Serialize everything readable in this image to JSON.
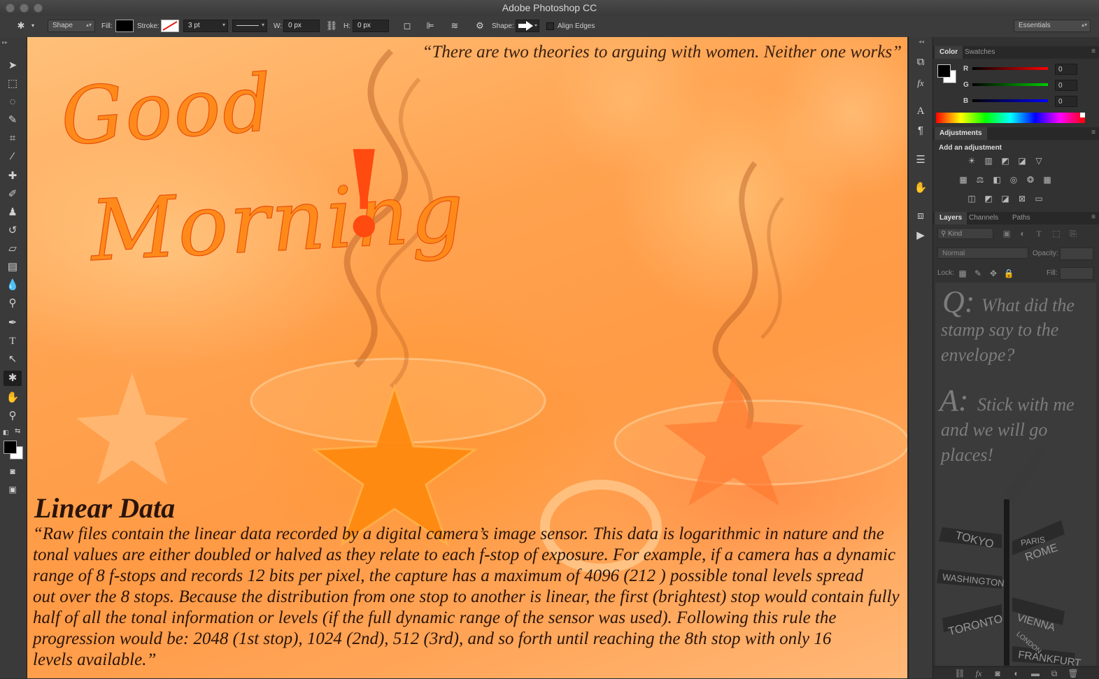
{
  "window": {
    "title": "Adobe Photoshop CC"
  },
  "options_bar": {
    "tool_mode": "Shape",
    "fill_label": "Fill:",
    "stroke_label": "Stroke:",
    "stroke_width": "3 pt",
    "w_label": "W:",
    "w_value": "0 px",
    "h_label": "H:",
    "h_value": "0 px",
    "shape_label": "Shape:",
    "align_edges_label": "Align Edges",
    "workspace": "Essentials"
  },
  "canvas": {
    "top_quote": "“There are two theories to arguing with women. Neither one works”",
    "title_word1": "Good",
    "title_word2": "Morning",
    "exclamation": "!",
    "heading": "Linear Data",
    "body_lines": [
      "“Raw files contain the linear data recorded by a digital camera’s image sensor. This data is logarithmic in nature and the",
      "tonal values are either doubled or halved as they relate to each f-stop of exposure. For example, if a camera has a dynamic",
      "range of 8 f-stops and records 12 bits per pixel, the capture has a maximum of 4096 (212 ) possible tonal levels spread",
      "out over the 8 stops. Because the distribution from one stop to another is linear, the first (brightest) stop would contain fully",
      "half of all the tonal information or levels (if the full dynamic range of the sensor was used). Following this rule the",
      "progression would be: 2048 (1st stop), 1024 (2nd), 512 (3rd), and so forth until reaching the 8th stop with only 16",
      "levels available.”"
    ]
  },
  "color_panel": {
    "tabs": [
      "Color",
      "Swatches"
    ],
    "r_label": "R",
    "r_value": "0",
    "g_label": "G",
    "g_value": "0",
    "b_label": "B",
    "b_value": "0"
  },
  "adjustments_panel": {
    "tab": "Adjustments",
    "heading": "Add an adjustment"
  },
  "layers_panel": {
    "tabs": [
      "Layers",
      "Channels",
      "Paths"
    ],
    "kind_filter": "Kind",
    "blend_mode": "Normal",
    "opacity_label": "Opacity:",
    "lock_label": "Lock:",
    "fill_label": "Fill:"
  },
  "side_art": {
    "q_letter": "Q:",
    "question_lines": [
      "What did the",
      "stamp say to the",
      "envelope?"
    ],
    "a_letter": "A:",
    "answer_lines": [
      "Stick with me",
      "and we will go",
      "places!"
    ],
    "signpost": [
      "TOKYO",
      "PARIS",
      "ROME",
      "WASHINGTON",
      "TORONTO",
      "VIENNA",
      "LONDON",
      "FRANKFURT"
    ]
  },
  "colors": {
    "canvas_orange": "#ffa24f",
    "ui_dark": "#323232",
    "text_brown": "#2a140a"
  }
}
